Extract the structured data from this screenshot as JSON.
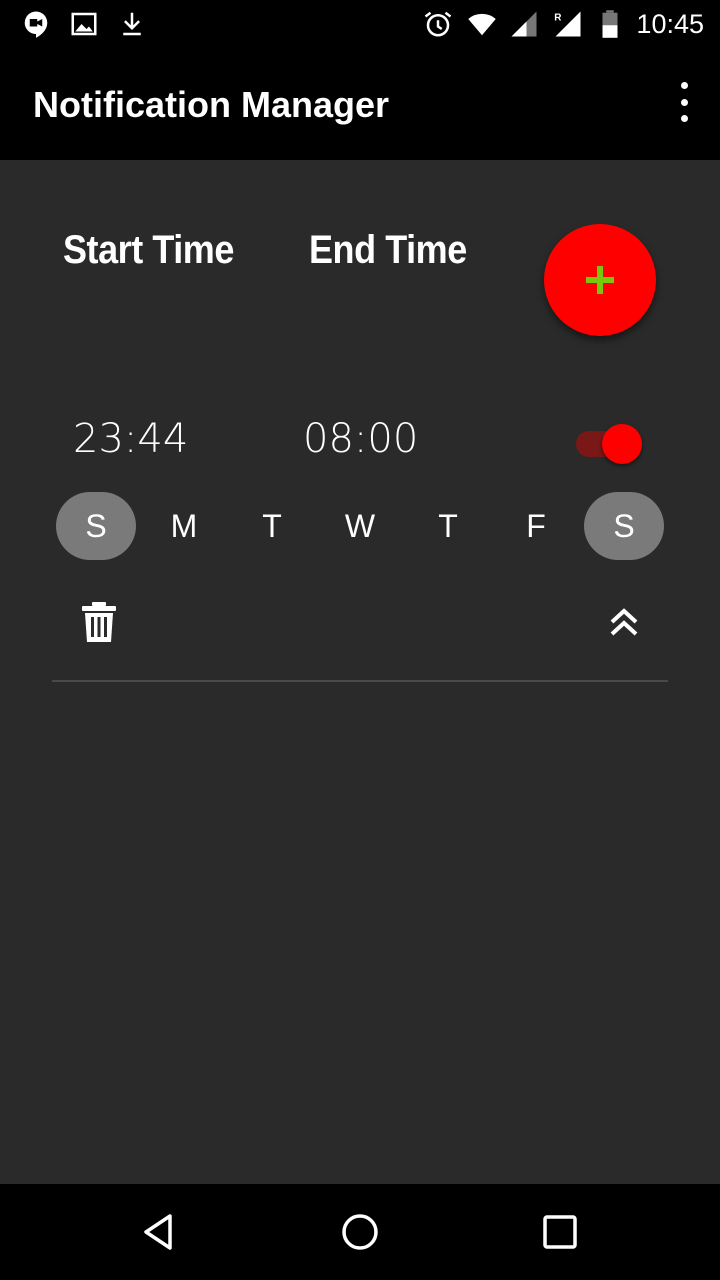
{
  "status_bar": {
    "time": "10:45",
    "icons": [
      "hangouts-icon",
      "image-icon",
      "download-icon",
      "alarm-icon",
      "wifi-icon",
      "cell-signal-icon",
      "roaming-signal-icon",
      "battery-icon"
    ]
  },
  "app_bar": {
    "title": "Notification Manager",
    "menu_icon": "overflow-menu-icon"
  },
  "headers": {
    "start": "Start Time",
    "end": "End Time"
  },
  "fab": {
    "icon": "plus-icon",
    "color": "#ff0000",
    "icon_color": "#7ac70c"
  },
  "schedule": {
    "start_time": "23:44",
    "end_time": "08:00",
    "enabled": true,
    "days": [
      {
        "label": "S",
        "selected": true
      },
      {
        "label": "M",
        "selected": false
      },
      {
        "label": "T",
        "selected": false
      },
      {
        "label": "W",
        "selected": false
      },
      {
        "label": "T",
        "selected": false
      },
      {
        "label": "F",
        "selected": false
      },
      {
        "label": "S",
        "selected": true
      }
    ],
    "delete_icon": "trash-icon",
    "collapse_icon": "double-chevron-up-icon"
  },
  "nav_bar": {
    "icons": [
      "back-icon",
      "home-icon",
      "recents-icon"
    ]
  },
  "colors": {
    "background": "#2a2a2a",
    "bar": "#000000",
    "accent": "#ff0000",
    "selected_day": "#7a7a7a"
  }
}
